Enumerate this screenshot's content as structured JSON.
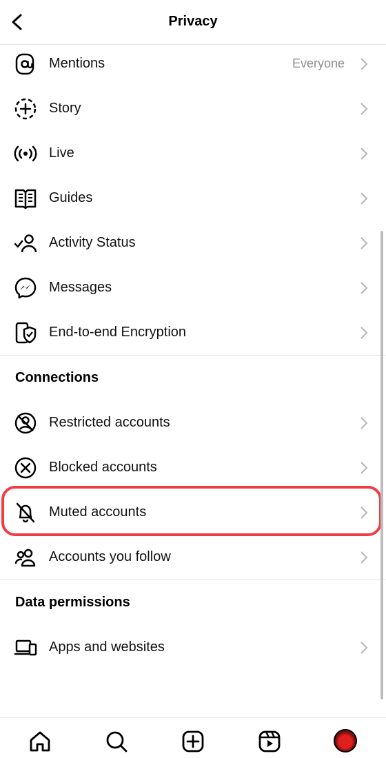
{
  "header": {
    "title": "Privacy"
  },
  "rows_top": [
    {
      "key": "mentions",
      "label": "Mentions",
      "value": "Everyone",
      "icon": "at-sign-icon"
    },
    {
      "key": "story",
      "label": "Story",
      "value": "",
      "icon": "story-add-icon"
    },
    {
      "key": "live",
      "label": "Live",
      "value": "",
      "icon": "live-broadcast-icon"
    },
    {
      "key": "guides",
      "label": "Guides",
      "value": "",
      "icon": "guide-book-icon"
    },
    {
      "key": "activity-status",
      "label": "Activity Status",
      "value": "",
      "icon": "activity-status-icon"
    },
    {
      "key": "messages",
      "label": "Messages",
      "value": "",
      "icon": "messenger-icon"
    },
    {
      "key": "e2ee",
      "label": "End-to-end Encryption",
      "value": "",
      "icon": "encryption-shield-icon"
    }
  ],
  "connections": {
    "title": "Connections",
    "items": [
      {
        "key": "restricted",
        "label": "Restricted accounts",
        "icon": "restricted-icon"
      },
      {
        "key": "blocked",
        "label": "Blocked accounts",
        "icon": "blocked-icon"
      },
      {
        "key": "muted",
        "label": "Muted accounts",
        "icon": "muted-bell-icon"
      },
      {
        "key": "follow",
        "label": "Accounts you follow",
        "icon": "people-icon"
      }
    ]
  },
  "data_permissions": {
    "title": "Data permissions",
    "items": [
      {
        "key": "apps",
        "label": "Apps and websites",
        "icon": "devices-icon"
      }
    ]
  },
  "tabbar": [
    "home-icon",
    "search-icon",
    "create-icon",
    "reels-icon",
    "profile-avatar"
  ],
  "colors": {
    "highlight": "#f23b43",
    "secondary_text": "#8e8e8e"
  }
}
